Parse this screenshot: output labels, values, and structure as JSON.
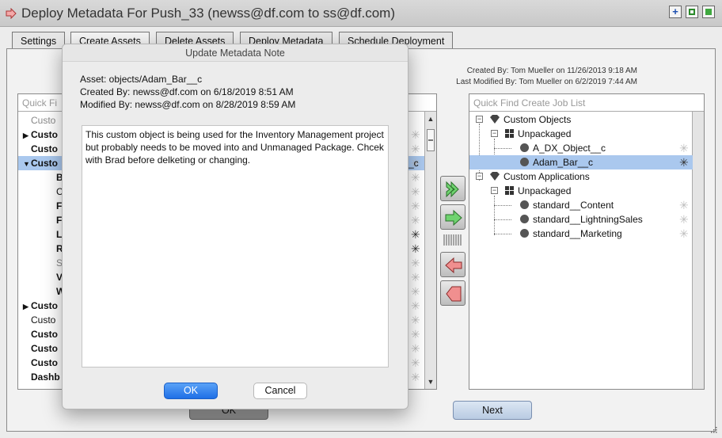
{
  "window": {
    "title": "Deploy Metadata For Push_33 (newss@df.com to ss@df.com)"
  },
  "tabs": [
    "Settings",
    "Create Assets",
    "Delete Assets",
    "Deploy Metadata",
    "Schedule Deployment"
  ],
  "info": {
    "created": "Created By: Tom Mueller on 11/26/2013 9:18 AM",
    "modified": "Last Modified By: Tom Mueller on 6/2/2019 7:44 AM"
  },
  "left_panel": {
    "search_placeholder": "Quick Fi",
    "rows": [
      {
        "label": "Custo",
        "style": "grey",
        "tri": ""
      },
      {
        "label": "Custo",
        "style": "bold",
        "tri": "▶"
      },
      {
        "label": "Custo",
        "style": "bold",
        "tri": ""
      },
      {
        "label": "Custo",
        "style": "bold sel",
        "tri": "▼"
      },
      {
        "label": "Bu",
        "style": "bold",
        "tri": ""
      },
      {
        "label": "Co",
        "style": "",
        "tri": ""
      },
      {
        "label": "Fie",
        "style": "bold",
        "tri": ""
      },
      {
        "label": "Fie",
        "style": "bold",
        "tri": ""
      },
      {
        "label": "Lis",
        "style": "bold",
        "tri": ""
      },
      {
        "label": "Re",
        "style": "bold",
        "tri": ""
      },
      {
        "label": "Sh",
        "style": "grey",
        "tri": ""
      },
      {
        "label": "Va",
        "style": "bold",
        "tri": ""
      },
      {
        "label": "We",
        "style": "bold",
        "tri": ""
      },
      {
        "label": "Custo",
        "style": "bold",
        "tri": "▶"
      },
      {
        "label": "Custo",
        "style": "",
        "tri": ""
      },
      {
        "label": "Custo",
        "style": "bold",
        "tri": ""
      },
      {
        "label": "Custo",
        "style": "bold",
        "tri": ""
      },
      {
        "label": "Custo",
        "style": "bold",
        "tri": ""
      },
      {
        "label": "Dashb",
        "style": "bold",
        "tri": ""
      }
    ],
    "partial_text": "_c"
  },
  "right_panel": {
    "search_placeholder": "Quick Find Create Job List",
    "tree": [
      {
        "label": "Custom Objects",
        "icon": "diamond",
        "level": 0
      },
      {
        "label": "Unpackaged",
        "icon": "grid",
        "level": 1
      },
      {
        "label": "A_DX_Object__c",
        "icon": "dot",
        "level": 2
      },
      {
        "label": "Adam_Bar__c",
        "icon": "dot",
        "level": 2,
        "selected": true
      },
      {
        "label": "Custom Applications",
        "icon": "diamond",
        "level": 0
      },
      {
        "label": "Unpackaged",
        "icon": "grid",
        "level": 1
      },
      {
        "label": "standard__Content",
        "icon": "dot",
        "level": 2
      },
      {
        "label": "standard__LightningSales",
        "icon": "dot",
        "level": 2
      },
      {
        "label": "standard__Marketing",
        "icon": "dot",
        "level": 2
      }
    ]
  },
  "buttons": {
    "ok_bg": "OK",
    "next": "Next"
  },
  "dialog": {
    "title": "Update Metadata Note",
    "asset": "Asset: objects/Adam_Bar__c",
    "created": "Created By: newss@df.com on 6/18/2019 8:51 AM",
    "modified": "Modified By: newss@df.com on 8/28/2019 8:59 AM",
    "note": "This custom object is being used for the Inventory Management project but probably needs to be moved into and Unmanaged Package. Chcek with Brad before delketing or changing.",
    "ok": "OK",
    "cancel": "Cancel"
  },
  "colors": {
    "selection": "#aac8ee",
    "ok_button": "#1f6fe6",
    "arrow_green": "#6fd36f",
    "arrow_red": "#f08f8f"
  }
}
